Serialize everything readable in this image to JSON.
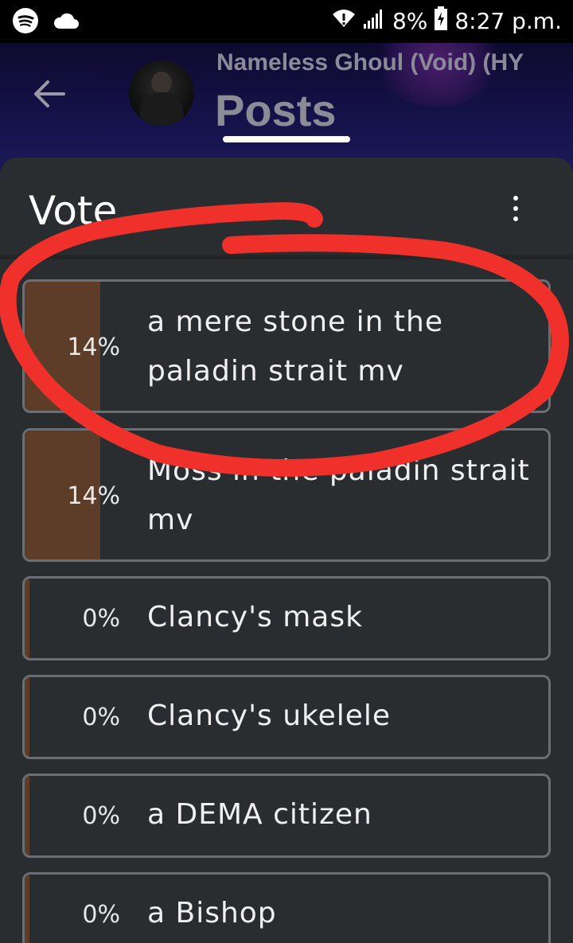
{
  "status_bar": {
    "battery": "8%",
    "time": "8:27 p.m.",
    "icons": [
      "spotify-icon",
      "cloud-icon",
      "wifi-icon",
      "signal-icon",
      "battery-charging-icon"
    ]
  },
  "header": {
    "subtitle": "Nameless Ghoul (Void) (HY",
    "title": "Posts"
  },
  "poll": {
    "title": "Vote",
    "accent_color": "#5d3d27",
    "options": [
      {
        "percent": "14%",
        "fraction": 0.14,
        "label": "a mere stone in the paladin strait mv"
      },
      {
        "percent": "14%",
        "fraction": 0.14,
        "label": "Moss in the paladin strait mv"
      },
      {
        "percent": "0%",
        "fraction": 0.0,
        "label": "Clancy's mask"
      },
      {
        "percent": "0%",
        "fraction": 0.0,
        "label": "Clancy's ukelele"
      },
      {
        "percent": "0%",
        "fraction": 0.0,
        "label": "a DEMA citizen"
      },
      {
        "percent": "0%",
        "fraction": 0.0,
        "label": "a Bishop"
      }
    ]
  },
  "annotation_color": "#f0302a"
}
